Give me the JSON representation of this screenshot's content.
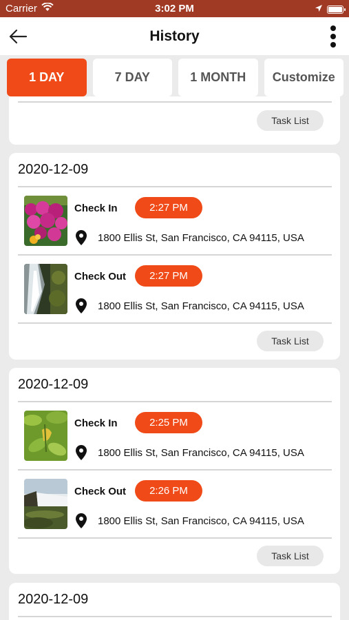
{
  "status_bar": {
    "carrier": "Carrier",
    "time": "3:02 PM"
  },
  "header": {
    "title": "History"
  },
  "tabs": [
    {
      "label": "1 DAY",
      "active": true
    },
    {
      "label": "7 DAY",
      "active": false
    },
    {
      "label": "1 MONTH",
      "active": false
    },
    {
      "label": "Customize",
      "active": false
    }
  ],
  "colors": {
    "accent": "#ef4a17",
    "status_bar": "#a13a25",
    "background": "#ebebeb"
  },
  "cards": [
    {
      "date": "",
      "task_list_label": "Task List",
      "entries": []
    },
    {
      "date": "2020-12-09",
      "task_list_label": "Task List",
      "entries": [
        {
          "label": "Check In",
          "time": "2:27 PM",
          "address": "1800 Ellis St, San Francisco, CA 94115, USA",
          "photo": "pink-flowers"
        },
        {
          "label": "Check Out",
          "time": "2:27 PM",
          "address": "1800 Ellis St, San Francisco, CA 94115, USA",
          "photo": "waterfall"
        }
      ]
    },
    {
      "date": "2020-12-09",
      "task_list_label": "Task List",
      "entries": [
        {
          "label": "Check In",
          "time": "2:25 PM",
          "address": "1800 Ellis St, San Francisco, CA 94115, USA",
          "photo": "leaves"
        },
        {
          "label": "Check Out",
          "time": "2:26 PM",
          "address": "1800 Ellis St, San Francisco, CA 94115, USA",
          "photo": "waterfall-landscape"
        }
      ]
    },
    {
      "date": "2020-12-09",
      "entries": []
    }
  ]
}
